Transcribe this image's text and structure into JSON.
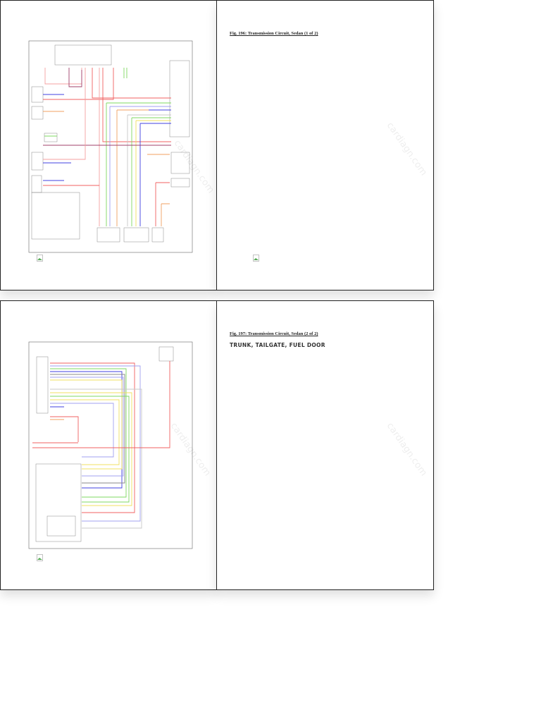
{
  "pages": [
    {
      "caption": "",
      "watermark": "cardiagn.com"
    },
    {
      "caption": "Fig. 196: Transmission Circuit, Sedan (1 of 2)",
      "watermark": "cardiagn.com"
    },
    {
      "caption": "",
      "watermark": "cardiagn.com"
    },
    {
      "caption": "Fig. 197: Transmission Circuit, Sedan (2 of 2)",
      "heading": "TRUNK, TAILGATE, FUEL DOOR",
      "watermark": "cardiagn.com"
    }
  ],
  "icons": {
    "image": "broken-image-icon"
  },
  "wire_colors": {
    "red": "#f06060",
    "pink": "#f4a0a0",
    "purple": "#a0406a",
    "green": "#7fd860",
    "yellow": "#f0e060",
    "blue": "#4040e0",
    "lightblue": "#a0a0f0",
    "orange": "#f0a060",
    "gray": "#c8c8c8"
  }
}
